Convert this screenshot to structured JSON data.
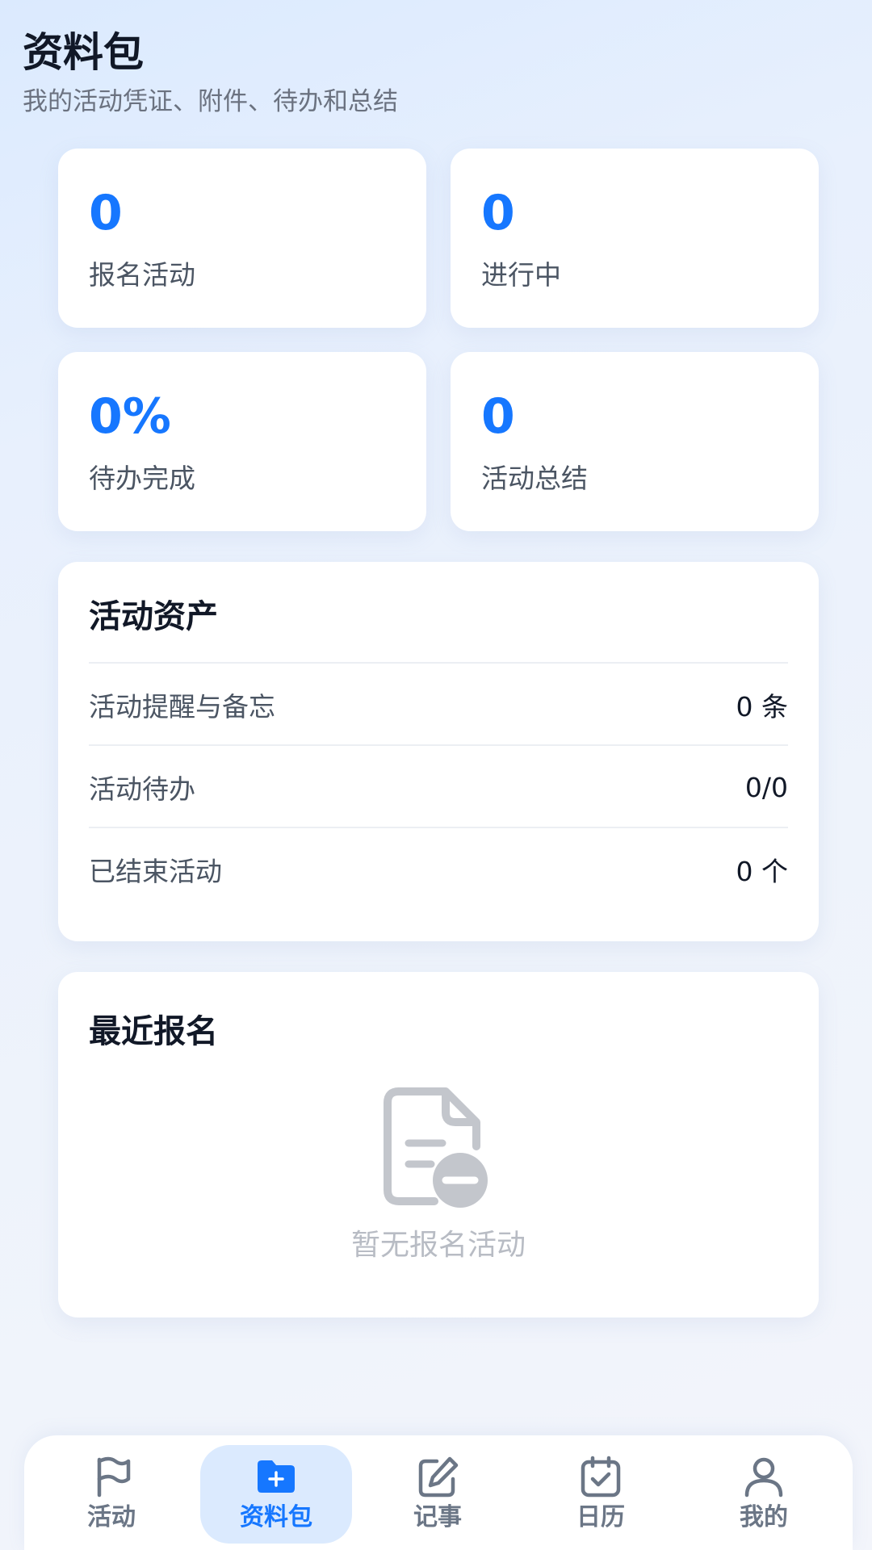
{
  "header": {
    "title": "资料包",
    "subtitle": "我的活动凭证、附件、待办和总结"
  },
  "stats": [
    {
      "value": "0",
      "label": "报名活动"
    },
    {
      "value": "0",
      "label": "进行中"
    },
    {
      "value": "0%",
      "label": "待办完成"
    },
    {
      "value": "0",
      "label": "活动总结"
    }
  ],
  "assets": {
    "title": "活动资产",
    "rows": [
      {
        "label": "活动提醒与备忘",
        "value": "0 条"
      },
      {
        "label": "活动待办",
        "value": "0/0"
      },
      {
        "label": "已结束活动",
        "value": "0 个"
      }
    ]
  },
  "recent": {
    "title": "最近报名",
    "empty_icon": "document-remove-icon",
    "empty_text": "暂无报名活动"
  },
  "tabbar": {
    "active": "资料包",
    "items": [
      {
        "label": "活动",
        "icon": "flag-icon"
      },
      {
        "label": "资料包",
        "icon": "folder-plus-icon"
      },
      {
        "label": "记事",
        "icon": "edit-note-icon"
      },
      {
        "label": "日历",
        "icon": "calendar-check-icon"
      },
      {
        "label": "我的",
        "icon": "user-icon"
      }
    ]
  },
  "colors": {
    "accent": "#1677ff",
    "accent_bg": "#dbeafe",
    "tab_inactive": "#6b7686",
    "empty": "#b8bcc4"
  }
}
